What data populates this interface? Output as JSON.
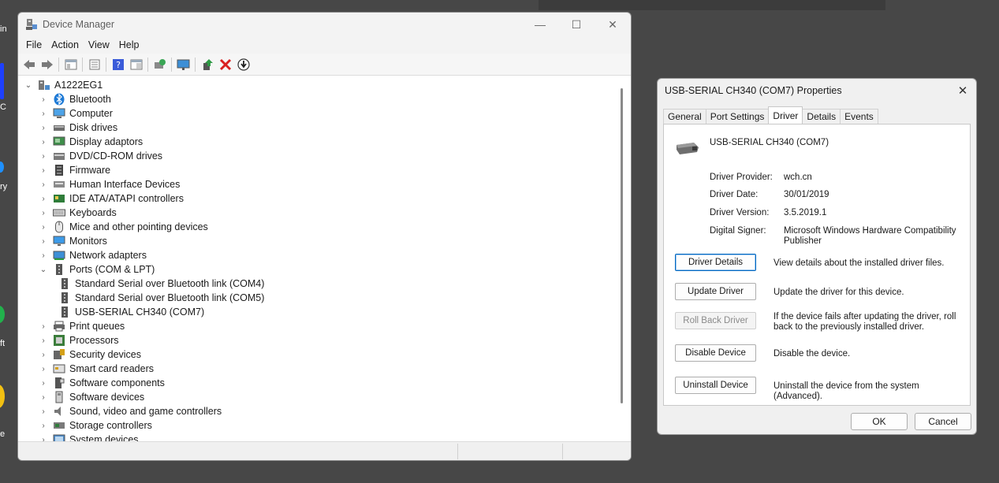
{
  "desktop": {
    "fragments": [
      "in",
      "C",
      "ry",
      "ft",
      "e"
    ]
  },
  "device_manager": {
    "title": "Device Manager",
    "window_controls": {
      "minimize": "—",
      "maximize": "☐",
      "close": "✕"
    },
    "menu": [
      "File",
      "Action",
      "View",
      "Help"
    ],
    "tree": {
      "root": "A1222EG1",
      "categories": [
        {
          "label": "Bluetooth",
          "icon": "bluetooth-icon",
          "expanded": false
        },
        {
          "label": "Computer",
          "icon": "computer-icon",
          "expanded": false
        },
        {
          "label": "Disk drives",
          "icon": "disk-drive-icon",
          "expanded": false
        },
        {
          "label": "Display adaptors",
          "icon": "display-adapter-icon",
          "expanded": false
        },
        {
          "label": "DVD/CD-ROM drives",
          "icon": "dvd-drive-icon",
          "expanded": false
        },
        {
          "label": "Firmware",
          "icon": "firmware-icon",
          "expanded": false
        },
        {
          "label": "Human Interface Devices",
          "icon": "hid-icon",
          "expanded": false
        },
        {
          "label": "IDE ATA/ATAPI controllers",
          "icon": "ide-controller-icon",
          "expanded": false
        },
        {
          "label": "Keyboards",
          "icon": "keyboard-icon",
          "expanded": false
        },
        {
          "label": "Mice and other pointing devices",
          "icon": "mouse-icon",
          "expanded": false
        },
        {
          "label": "Monitors",
          "icon": "monitor-icon",
          "expanded": false
        },
        {
          "label": "Network adapters",
          "icon": "network-adapter-icon",
          "expanded": false
        },
        {
          "label": "Ports (COM & LPT)",
          "icon": "port-icon",
          "expanded": true
        },
        {
          "label": "Standard Serial over Bluetooth link (COM4)",
          "icon": "port-icon",
          "child": true
        },
        {
          "label": "Standard Serial over Bluetooth link (COM5)",
          "icon": "port-icon",
          "child": true
        },
        {
          "label": "USB-SERIAL CH340 (COM7)",
          "icon": "port-icon",
          "child": true
        },
        {
          "label": "Print queues",
          "icon": "printer-icon",
          "expanded": false
        },
        {
          "label": "Processors",
          "icon": "processor-icon",
          "expanded": false
        },
        {
          "label": "Security devices",
          "icon": "security-device-icon",
          "expanded": false
        },
        {
          "label": "Smart card readers",
          "icon": "smart-card-icon",
          "expanded": false
        },
        {
          "label": "Software components",
          "icon": "software-component-icon",
          "expanded": false
        },
        {
          "label": "Software devices",
          "icon": "software-device-icon",
          "expanded": false
        },
        {
          "label": "Sound, video and game controllers",
          "icon": "sound-icon",
          "expanded": false
        },
        {
          "label": "Storage controllers",
          "icon": "storage-controller-icon",
          "expanded": false
        },
        {
          "label": "System devices",
          "icon": "system-device-icon",
          "expanded": false
        }
      ]
    }
  },
  "properties": {
    "title": "USB-SERIAL CH340 (COM7) Properties",
    "close": "✕",
    "tabs": [
      "General",
      "Port Settings",
      "Driver",
      "Details",
      "Events"
    ],
    "active_tab": "Driver",
    "device_name": "USB-SERIAL CH340 (COM7)",
    "fields": [
      {
        "label": "Driver Provider:",
        "value": "wch.cn"
      },
      {
        "label": "Driver Date:",
        "value": "30/01/2019"
      },
      {
        "label": "Driver Version:",
        "value": "3.5.2019.1"
      },
      {
        "label": "Digital Signer:",
        "value": "Microsoft Windows Hardware Compatibility Publisher"
      }
    ],
    "buttons": [
      {
        "label": "Driver Details",
        "desc": "View details about the installed driver files."
      },
      {
        "label": "Update Driver",
        "desc": "Update the driver for this device."
      },
      {
        "label": "Roll Back Driver",
        "desc": "If the device fails after updating the driver, roll back to the previously installed driver."
      },
      {
        "label": "Disable Device",
        "desc": "Disable the device."
      },
      {
        "label": "Uninstall Device",
        "desc": "Uninstall the device from the system (Advanced)."
      }
    ],
    "ok": "OK",
    "cancel": "Cancel"
  }
}
